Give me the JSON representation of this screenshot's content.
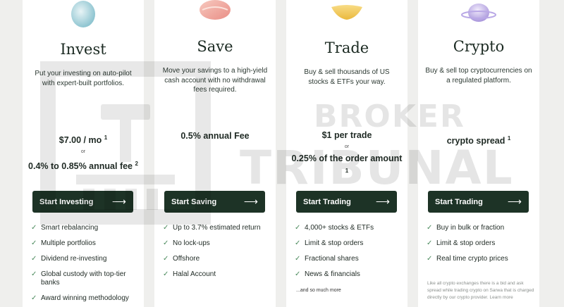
{
  "plans": [
    {
      "title": "Invest",
      "description": "Put your investing on auto-pilot with expert-built portfolios.",
      "price_line1": "$7.00 / mo",
      "price_line1_note": "1",
      "or_label": "or",
      "price_line2": "0.4% to 0.85% annual fee",
      "price_line2_note": "2",
      "cta_label": "Start Investing",
      "features": [
        "Smart rebalancing",
        "Multiple portfolios",
        "Dividend re-investing",
        "Global custody with top-tier banks",
        "Award winning methodology"
      ]
    },
    {
      "title": "Save",
      "description": "Move your savings to a high-yield cash account with no withdrawal fees required.",
      "price_line1": "0.5% annual Fee",
      "cta_label": "Start Saving",
      "features": [
        "Up to 3.7% estimated return",
        "No lock-ups",
        "Offshore",
        "Halal Account"
      ]
    },
    {
      "title": "Trade",
      "description": "Buy & sell thousands of US stocks & ETFs your way.",
      "price_line1": "$1 per trade",
      "or_label": "or",
      "price_line2": "0.25% of the order amount",
      "price_line2_note": "1",
      "cta_label": "Start Trading",
      "features": [
        "4,000+ stocks & ETFs",
        "Limit & stop orders",
        "Fractional shares",
        "News & financials"
      ],
      "more": "...and so much more"
    },
    {
      "title": "Crypto",
      "description": "Buy & sell top cryptocurrencies on a regulated platform.",
      "price_line1": "crypto spread",
      "price_line1_note": "1",
      "cta_label": "Start Trading",
      "features": [
        "Buy in bulk or fraction",
        "Limit & stop orders",
        "Real time crypto prices"
      ],
      "fine_print": "Like all crypto exchanges there is a bid and ask spread while trading crypto on Sarwa that is charged directly by our crypto provider. Learn more"
    }
  ],
  "watermark": {
    "line1": "BROKER",
    "line2": "TRIBUNAL"
  },
  "icons": {
    "check": "check-icon",
    "arrow": "arrow-right-icon"
  },
  "colors": {
    "button_bg": "#1d3326",
    "check": "#4a8a5c"
  }
}
